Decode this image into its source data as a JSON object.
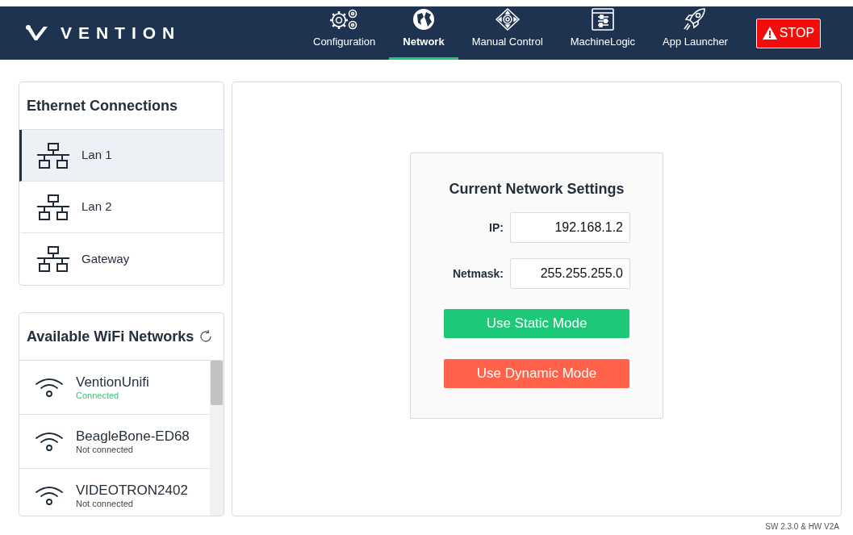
{
  "header": {
    "logo": "VENTION",
    "tabs": [
      {
        "label": "Configuration",
        "selected": false
      },
      {
        "label": "Network",
        "selected": true
      },
      {
        "label": "Manual Control",
        "selected": false
      },
      {
        "label": "MachineLogic",
        "selected": false
      },
      {
        "label": "App Launcher",
        "selected": false
      }
    ],
    "stop_button": "STOP"
  },
  "ethernet": {
    "title": "Ethernet Connections",
    "items": [
      {
        "label": "Lan 1",
        "selected": true
      },
      {
        "label": "Lan 2",
        "selected": false
      },
      {
        "label": "Gateway",
        "selected": false
      }
    ]
  },
  "wifi": {
    "title": "Available WiFi Networks",
    "networks": [
      {
        "name": "VentionUnifi",
        "status": "Connected",
        "connected": true
      },
      {
        "name": "BeagleBone-ED68",
        "status": "Not connected",
        "connected": false
      },
      {
        "name": "VIDEOTRON2402",
        "status": "Not connected",
        "connected": false
      }
    ]
  },
  "settings": {
    "title": "Current Network Settings",
    "fields": [
      {
        "label": "IP:",
        "value": "192.168.1.2"
      },
      {
        "label": "Netmask:",
        "value": "255.255.255.0"
      }
    ],
    "buttons": [
      {
        "label": "Use Static Mode",
        "kind": "static"
      },
      {
        "label": "Use Dynamic Mode",
        "kind": "dynamic"
      }
    ]
  },
  "version": "SW 2.3.0 & HW V2A"
}
